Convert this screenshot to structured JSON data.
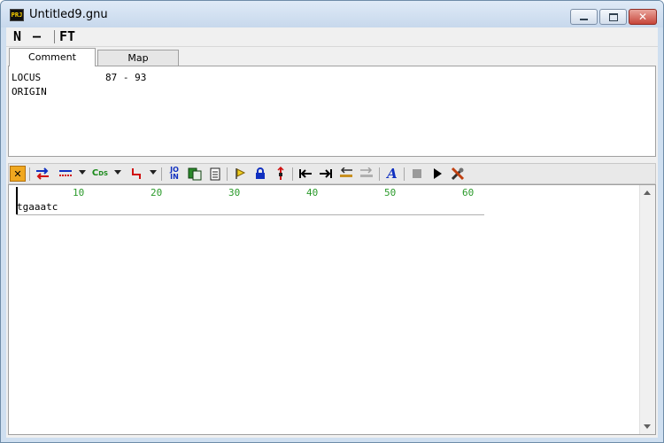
{
  "window": {
    "title": "Untitled9.gnu",
    "app_icon_text": "PRJ"
  },
  "menu": {
    "items": [
      "N",
      "—",
      "FT"
    ]
  },
  "tabs": [
    {
      "label": "Comment",
      "active": true
    },
    {
      "label": "Map",
      "active": false
    }
  ],
  "comment": {
    "lines": [
      "LOCUS           87 - 93",
      "ORIGIN"
    ]
  },
  "toolbar": {
    "icons": [
      "close-x",
      "swap",
      "dashed-line",
      "cds",
      "angle-arrow",
      "join",
      "copy-paste",
      "document",
      "flag",
      "lock",
      "marker",
      "go-start",
      "go-end",
      "shift-left",
      "shift-right",
      "font-A",
      "stop",
      "play",
      "tools"
    ]
  },
  "sequence": {
    "ruler": [
      "10",
      "20",
      "30",
      "40",
      "50",
      "60"
    ],
    "text": "tgaaatc"
  },
  "colors": {
    "ruler": "#2a9a2a",
    "accent_red": "#d01010",
    "accent_blue": "#1030c0",
    "close_bg": "#f0a820"
  }
}
